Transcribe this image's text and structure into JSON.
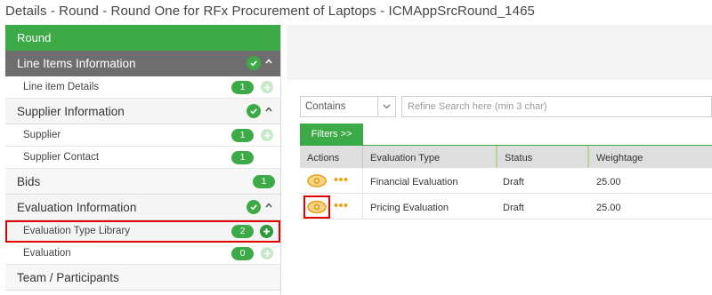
{
  "page": {
    "title": "Details  - Round  -  Round One for RFx Procurement of Laptops  - ICMAppSrcRound_1465"
  },
  "sidebar": {
    "header": "Round",
    "line_items": {
      "label": "Line Items Information",
      "items": [
        {
          "label": "Line item Details",
          "count": "1"
        }
      ]
    },
    "supplier": {
      "label": "Supplier Information",
      "items": [
        {
          "label": "Supplier",
          "count": "1"
        },
        {
          "label": "Supplier Contact",
          "count": "1"
        }
      ]
    },
    "bids": {
      "label": "Bids",
      "count": "1"
    },
    "evaluation": {
      "label": "Evaluation Information",
      "items": [
        {
          "label": "Evaluation Type Library",
          "count": "2"
        },
        {
          "label": "Evaluation",
          "count": "0"
        }
      ]
    },
    "team": {
      "label": "Team / Participants"
    }
  },
  "search": {
    "match_mode": "Contains",
    "placeholder": "Refine Search here (min 3 char)"
  },
  "filters_label": "Filters >>",
  "grid": {
    "headers": {
      "actions": "Actions",
      "evaluation_type": "Evaluation Type",
      "status": "Status",
      "weightage": "Weightage"
    },
    "rows": [
      {
        "evaluation_type": "Financial Evaluation",
        "status": "Draft",
        "weightage": "25.00"
      },
      {
        "evaluation_type": "Pricing Evaluation",
        "status": "Draft",
        "weightage": "25.00"
      }
    ]
  },
  "colors": {
    "brand_green": "#3daa48",
    "dark_section": "#6e6e6e",
    "highlight_red": "#e00000",
    "eye_orange": "#e8a317"
  },
  "icons": {
    "check": "check-circle-icon",
    "collapse": "chevron-up-icon",
    "add": "plus-circle-icon",
    "view": "eye-icon",
    "more": "more-dots-icon",
    "dropdown": "chevron-down-icon"
  }
}
